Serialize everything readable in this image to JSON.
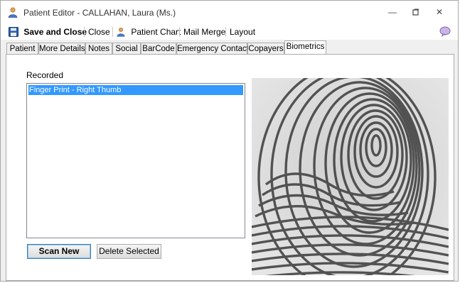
{
  "window": {
    "title": "Patient Editor - CALLAHAN, Laura (Ms.)"
  },
  "toolbar": {
    "save_close": "Save and Close",
    "close": "Close",
    "patient_chart": "Patient Chart",
    "mail_merge": "Mail Merge",
    "layout": "Layout"
  },
  "tabs": [
    {
      "label": "Patient"
    },
    {
      "label": "More Details"
    },
    {
      "label": "Notes"
    },
    {
      "label": "Social"
    },
    {
      "label": "BarCode"
    },
    {
      "label": "Emergency Contacts"
    },
    {
      "label": "Copayers"
    },
    {
      "label": "Biometrics"
    }
  ],
  "biometrics": {
    "recorded_label": "Recorded",
    "items": [
      {
        "label": "Finger Print - Right Thumb"
      }
    ],
    "scan_new": "Scan New",
    "delete_selected": "Delete Selected"
  }
}
